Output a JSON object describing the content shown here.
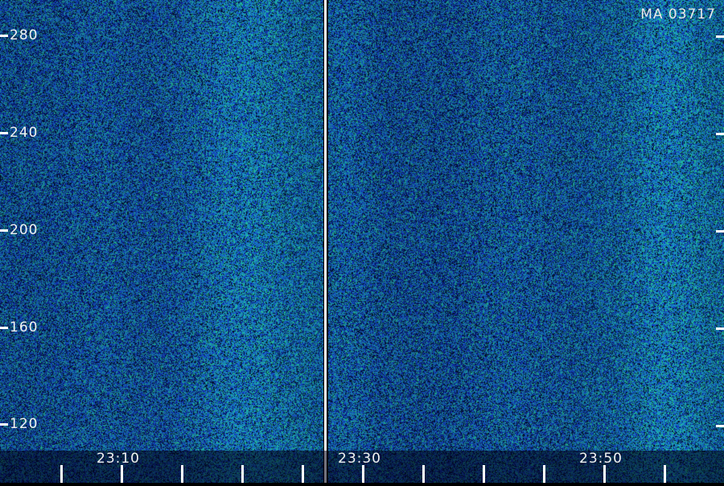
{
  "chart_data": {
    "type": "heatmap",
    "title": "",
    "station_label": "MA 03717",
    "xlabel": "",
    "ylabel": "",
    "panels": [
      {
        "name": "",
        "x_tick_labels": [
          "23:10"
        ]
      },
      {
        "name": "",
        "x_tick_labels": [
          "23:30",
          "23:50"
        ]
      }
    ],
    "y_tick_labels": [
      "280",
      "240",
      "200",
      "160",
      "120"
    ],
    "y_ticks": [
      280,
      240,
      200,
      160,
      120
    ],
    "grid": false,
    "colorscale": [
      "#000814",
      "#0a1f6e",
      "#1d3fd6",
      "#1aa6c8",
      "#27e08a"
    ]
  }
}
